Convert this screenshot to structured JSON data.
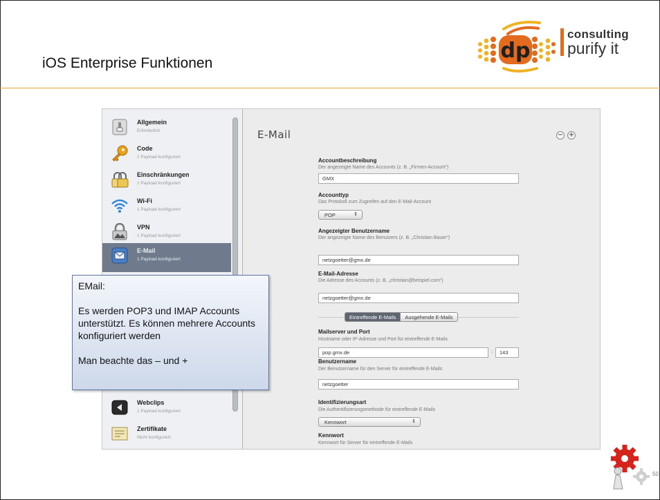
{
  "slide": {
    "title": "iOS Enterprise Funktionen",
    "page_number": "50"
  },
  "logo": {
    "line1": "consulting",
    "line2": "purify it",
    "mark_text": "dp",
    "colors": {
      "orange": "#e26b1f",
      "gold": "#f0b323",
      "dark": "#1f1f1f"
    }
  },
  "sidebar": {
    "items": [
      {
        "name": "Allgemein",
        "sub": "Erforderlich",
        "icon": "switch-icon"
      },
      {
        "name": "Code",
        "sub": "1 Payload konfiguriert",
        "icon": "key-icon"
      },
      {
        "name": "Einschränkungen",
        "sub": "1 Payload konfiguriert",
        "icon": "restrictions-icon"
      },
      {
        "name": "Wi-Fi",
        "sub": "1 Payload konfiguriert",
        "icon": "wifi-icon"
      },
      {
        "name": "VPN",
        "sub": "1 Payload konfiguriert",
        "icon": "vpn-lock-icon"
      },
      {
        "name": "E-Mail",
        "sub": "1 Payload konfiguriert",
        "icon": "mail-icon",
        "active": true
      },
      {
        "name": "Webclips",
        "sub": "1 Payload konfiguriert",
        "icon": "webclip-icon"
      },
      {
        "name": "Zertifikate",
        "sub": "Nicht konfiguriert",
        "icon": "certificate-icon"
      }
    ]
  },
  "pane": {
    "title": "E-Mail",
    "minus": "−",
    "plus": "+",
    "fields": {
      "account_desc": {
        "label": "Accountbeschreibung",
        "desc": "Der angezeigte Name des Accounts (z. B. „Firmen-Account“)",
        "value": "GMX"
      },
      "account_type": {
        "label": "Accounttyp",
        "desc": "Das Protokoll zum Zugreifen auf den E-Mail-Account",
        "value": "POP"
      },
      "display_user": {
        "label": "Angezeigter Benutzername",
        "desc": "Der angezeigte Name des Benutzers (z. B. „Christian Bauer“)",
        "value": "netzgoetter@gmx.de"
      },
      "email": {
        "label": "E-Mail-Adresse",
        "desc": "Die Adresse des Accounts (z. B. „christian@beispiel.com“)",
        "value": "netzgoetter@gmx.de"
      },
      "mailserver": {
        "label": "Mailserver und Port",
        "desc": "Hostname oder IP-Adresse und Port für eintreffende E-Mails",
        "value": "pop.gmx.de",
        "port": "143"
      },
      "username": {
        "label": "Benutzername",
        "desc": "Der Benutzername für den Server für eintreffende E-Mails",
        "value": "netzgoetter"
      },
      "auth": {
        "label": "Identifizierungsart",
        "desc": "Die Authentifizierungsmethode für eintreffende E-Mails",
        "value": "Kennwort"
      },
      "password": {
        "label": "Kennwort",
        "desc": "Kennwort für Server für eintreffende E-Mails"
      }
    },
    "segments": {
      "incoming": "Eintreffende E-Mails",
      "outgoing": "Ausgehende E-Mails"
    },
    "select_arrow": "⇕",
    "port_sep": ":"
  },
  "callout": {
    "heading": "EMail:",
    "para1": "Es werden POP3 und IMAP Accounts unterstützt. Es können mehrere Accounts konfiguriert werden",
    "para2": "Man beachte das – und +"
  }
}
